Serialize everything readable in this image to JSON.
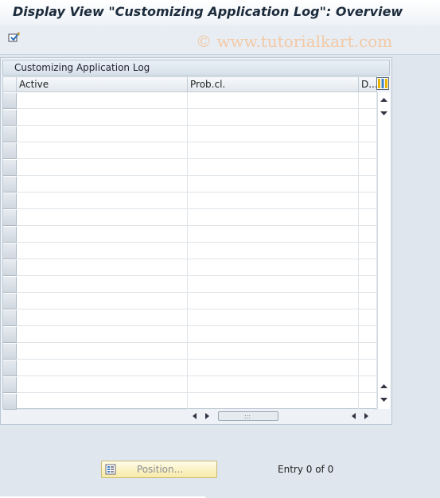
{
  "window": {
    "title": "Display View \"Customizing Application Log\": Overview"
  },
  "toolbar": {
    "watermark": "© www.tutorialkart.com"
  },
  "table": {
    "title": "Customizing Application Log",
    "columns": [
      "Active",
      "Prob.cl.",
      "D..."
    ],
    "row_count_visible": 19
  },
  "footer": {
    "position_label": "Position...",
    "entry_text": "Entry 0 of 0"
  }
}
